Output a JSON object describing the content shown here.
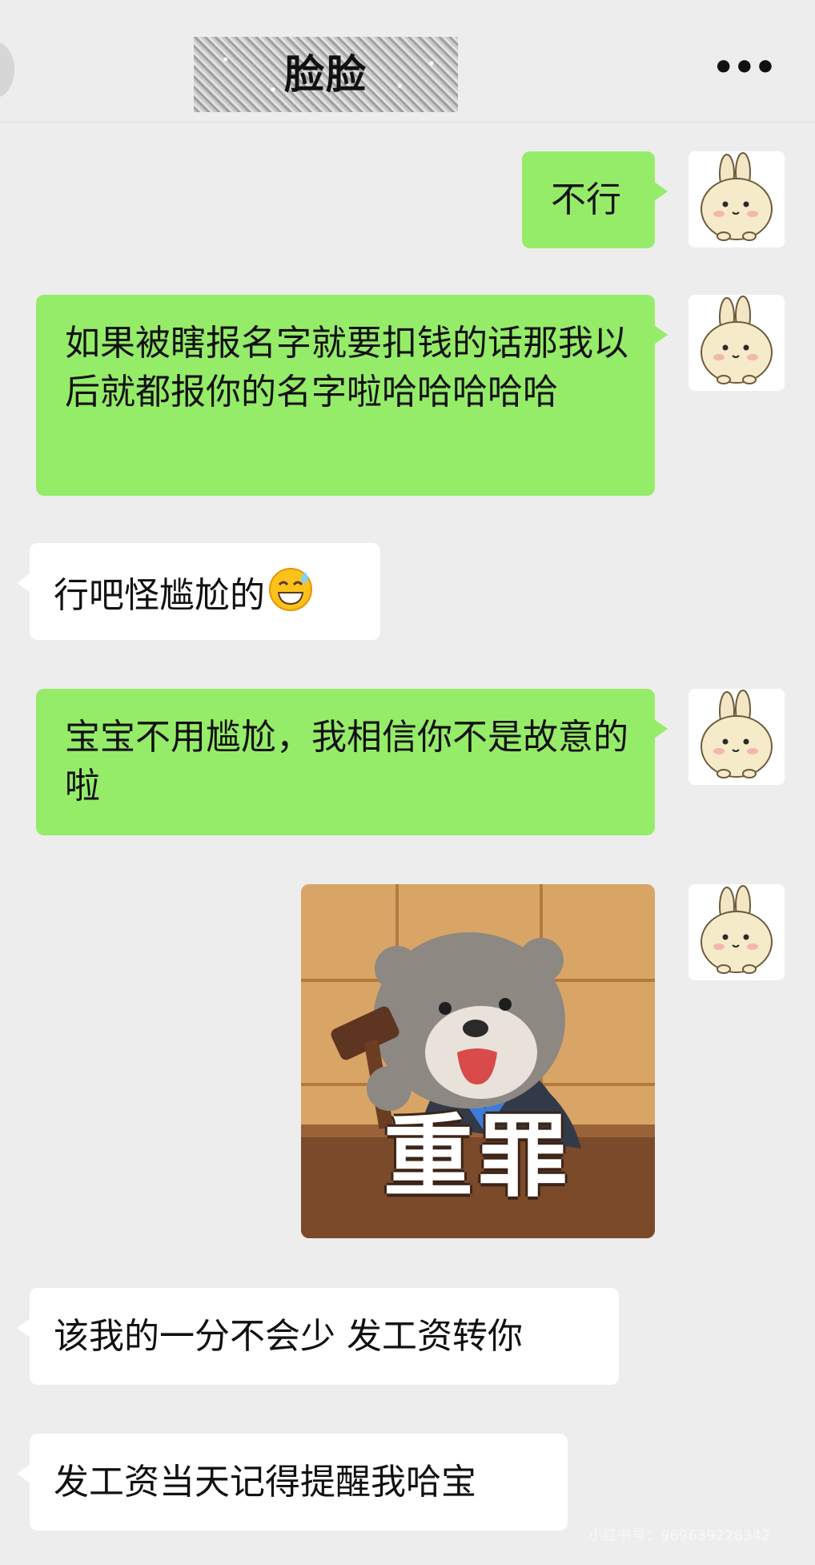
{
  "header": {
    "title": "脸脸",
    "more_icon": "ellipsis-icon"
  },
  "messages": [
    {
      "side": "me",
      "text": "不行"
    },
    {
      "side": "me",
      "text": "如果被瞎报名字就要扣钱的话那我以后就都报你的名字啦哈哈哈哈哈"
    },
    {
      "side": "other",
      "text": "行吧怪尴尬的",
      "emoji": "grinning-sweat-emoji"
    },
    {
      "side": "me",
      "text": "宝宝不用尴尬，我相信你不是故意的啦"
    },
    {
      "side": "me",
      "type": "sticker",
      "caption": "重罪",
      "icon": "judge-bear-sticker"
    },
    {
      "side": "other",
      "text": "该我的一分不会少 发工资转你"
    },
    {
      "side": "other",
      "text": "发工资当天记得提醒我哈宝"
    }
  ],
  "colors": {
    "background": "#ededed",
    "my_bubble": "#95ec69",
    "other_bubble": "#ffffff"
  },
  "watermark": "小红书号：969639228342"
}
